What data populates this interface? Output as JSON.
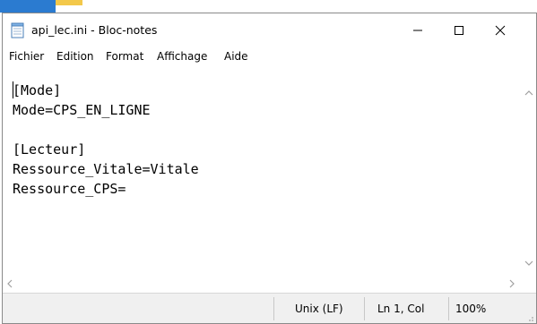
{
  "window": {
    "title": "api_lec.ini - Bloc-notes",
    "icon": "notepad-icon",
    "controls": {
      "minimize": "minimize-icon",
      "maximize": "maximize-icon",
      "close": "close-icon"
    }
  },
  "menu": {
    "items": [
      "Fichier",
      "Edition",
      "Format",
      "Affichage",
      "Aide"
    ]
  },
  "editor": {
    "lines": [
      "[Mode]",
      "Mode=CPS_EN_LIGNE",
      "",
      "[Lecteur]",
      "Ressource_Vitale=Vitale",
      "Ressource_CPS="
    ]
  },
  "status": {
    "line_ending": "Unix (LF)",
    "position": "Ln 1, Col",
    "zoom": "100%"
  },
  "colors": {
    "background": "#ffffff",
    "statusbar": "#f0f0f0",
    "scroll_arrow": "#a0a0a0"
  }
}
